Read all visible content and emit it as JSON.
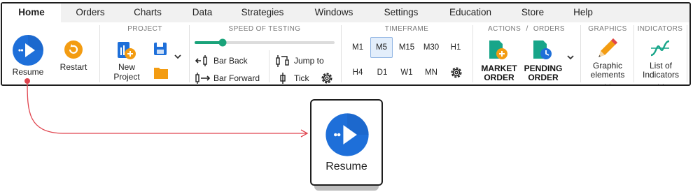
{
  "tabs": [
    "Home",
    "Orders",
    "Charts",
    "Data",
    "Strategies",
    "Windows",
    "Settings",
    "Education",
    "Store",
    "Help"
  ],
  "active_tab": "Home",
  "home": {
    "resume_label": "Resume",
    "restart_label": "Restart"
  },
  "project": {
    "title": "PROJECT",
    "new_label_1": "New",
    "new_label_2": "Project"
  },
  "speed": {
    "title": "SPEED OF TESTING",
    "slider_level": 0.2,
    "bar_back": "Bar Back",
    "bar_forward": "Bar Forward",
    "jump_to": "Jump to",
    "tick": "Tick"
  },
  "timeframe": {
    "title": "TIMEFRAME",
    "row1": [
      "M1",
      "M5",
      "M15",
      "M30",
      "H1"
    ],
    "row2": [
      "H4",
      "D1",
      "W1",
      "MN"
    ],
    "selected": "M5"
  },
  "actions": {
    "title_1": "ACTIONS",
    "title_sep": "/",
    "title_2": "ORDERS",
    "market_1": "MARKET",
    "market_2": "ORDER",
    "pending_1": "PENDING",
    "pending_2": "ORDER"
  },
  "graphics": {
    "title": "GRAPHICS",
    "label_1": "Graphic",
    "label_2": "elements"
  },
  "indicators": {
    "title": "INDICATORS",
    "label_1": "List of",
    "label_2": "Indicators"
  },
  "callout": {
    "label": "Resume"
  },
  "colors": {
    "accent_blue": "#1e6fd9",
    "orange": "#f39c12",
    "teal": "#17a589",
    "arrow_red": "#e0454f",
    "slider_green": "#1aa37a"
  }
}
